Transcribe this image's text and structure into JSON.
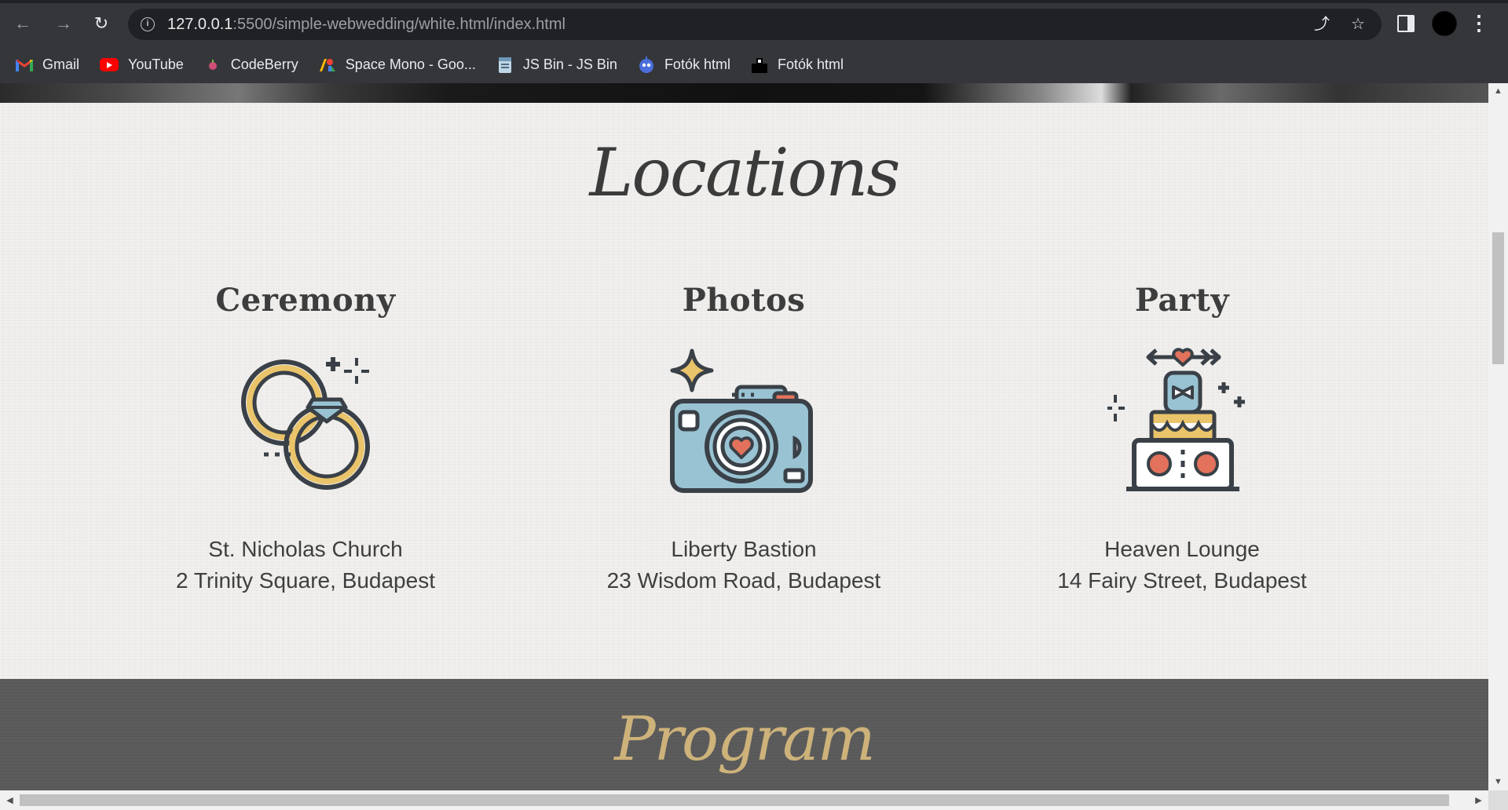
{
  "browser": {
    "url_host": "127.0.0.1",
    "url_rest": ":5500/simple-webwedding/white.html/index.html",
    "bookmarks": [
      {
        "label": "Gmail",
        "icon": "gmail-icon"
      },
      {
        "label": "YouTube",
        "icon": "youtube-icon"
      },
      {
        "label": "CodeBerry",
        "icon": "codeberry-icon"
      },
      {
        "label": "Space Mono - Goo...",
        "icon": "google-fonts-icon"
      },
      {
        "label": "JS Bin - JS Bin",
        "icon": "jsbin-icon"
      },
      {
        "label": "Fotók html",
        "icon": "robot-icon"
      },
      {
        "label": "Fotók html",
        "icon": "folder-dark-icon"
      }
    ]
  },
  "page": {
    "locations_title": "Locations",
    "locations": [
      {
        "heading": "Ceremony",
        "icon": "wedding-rings-icon",
        "place": "St. Nicholas Church",
        "address": "2 Trinity Square, Budapest"
      },
      {
        "heading": "Photos",
        "icon": "camera-icon",
        "place": "Liberty Bastion",
        "address": "23 Wisdom Road, Budapest"
      },
      {
        "heading": "Party",
        "icon": "wedding-cake-icon",
        "place": "Heaven Lounge",
        "address": "14 Fairy Street, Budapest"
      }
    ],
    "program_title": "Program"
  },
  "colors": {
    "gold": "#e9c46a",
    "dark_outline": "#3a4047",
    "camera_blue": "#99c3d3",
    "coral": "#e2725b",
    "program_title": "#cdb27a"
  }
}
